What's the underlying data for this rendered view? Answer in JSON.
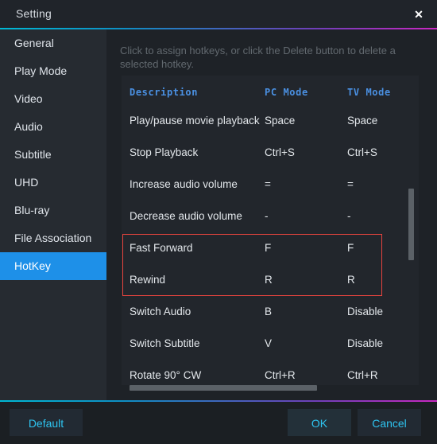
{
  "window": {
    "title": "Setting",
    "close_icon": "close-icon"
  },
  "sidebar": {
    "items": [
      {
        "label": "General",
        "active": false
      },
      {
        "label": "Play Mode",
        "active": false
      },
      {
        "label": "Video",
        "active": false
      },
      {
        "label": "Audio",
        "active": false
      },
      {
        "label": "Subtitle",
        "active": false
      },
      {
        "label": "UHD",
        "active": false
      },
      {
        "label": "Blu-ray",
        "active": false
      },
      {
        "label": "File Association",
        "active": false
      },
      {
        "label": "HotKey",
        "active": true
      }
    ]
  },
  "content": {
    "hint": "Click to assign hotkeys, or click the Delete button to delete a selected hotkey.",
    "table": {
      "headers": [
        "Description",
        "PC Mode",
        "TV Mode"
      ],
      "rows": [
        {
          "description": "Play/pause movie playback",
          "pc_mode": "Space",
          "tv_mode": "Space",
          "highlighted": false
        },
        {
          "description": "Stop Playback",
          "pc_mode": "Ctrl+S",
          "tv_mode": "Ctrl+S",
          "highlighted": false
        },
        {
          "description": "Increase audio volume",
          "pc_mode": "=",
          "tv_mode": "=",
          "highlighted": false
        },
        {
          "description": "Decrease audio volume",
          "pc_mode": "-",
          "tv_mode": "-",
          "highlighted": false
        },
        {
          "description": "Fast Forward",
          "pc_mode": "F",
          "tv_mode": "F",
          "highlighted": true
        },
        {
          "description": "Rewind",
          "pc_mode": "R",
          "tv_mode": "R",
          "highlighted": true
        },
        {
          "description": "Switch Audio",
          "pc_mode": "B",
          "tv_mode": "Disable",
          "highlighted": false
        },
        {
          "description": "Switch Subtitle",
          "pc_mode": "V",
          "tv_mode": "Disable",
          "highlighted": false
        },
        {
          "description": "Rotate 90° CW",
          "pc_mode": "Ctrl+R",
          "tv_mode": "Ctrl+R",
          "highlighted": false
        }
      ]
    }
  },
  "footer": {
    "default_label": "Default",
    "ok_label": "OK",
    "cancel_label": "Cancel"
  },
  "colors": {
    "accent_blue": "#1e90e8",
    "link_cyan": "#2ec4f0",
    "header_blue": "#4a90e2",
    "highlight_red": "#e8443e",
    "dialog_bg": "#1e2227",
    "sidebar_bg": "#262b31",
    "panel_bg": "#22262c"
  }
}
